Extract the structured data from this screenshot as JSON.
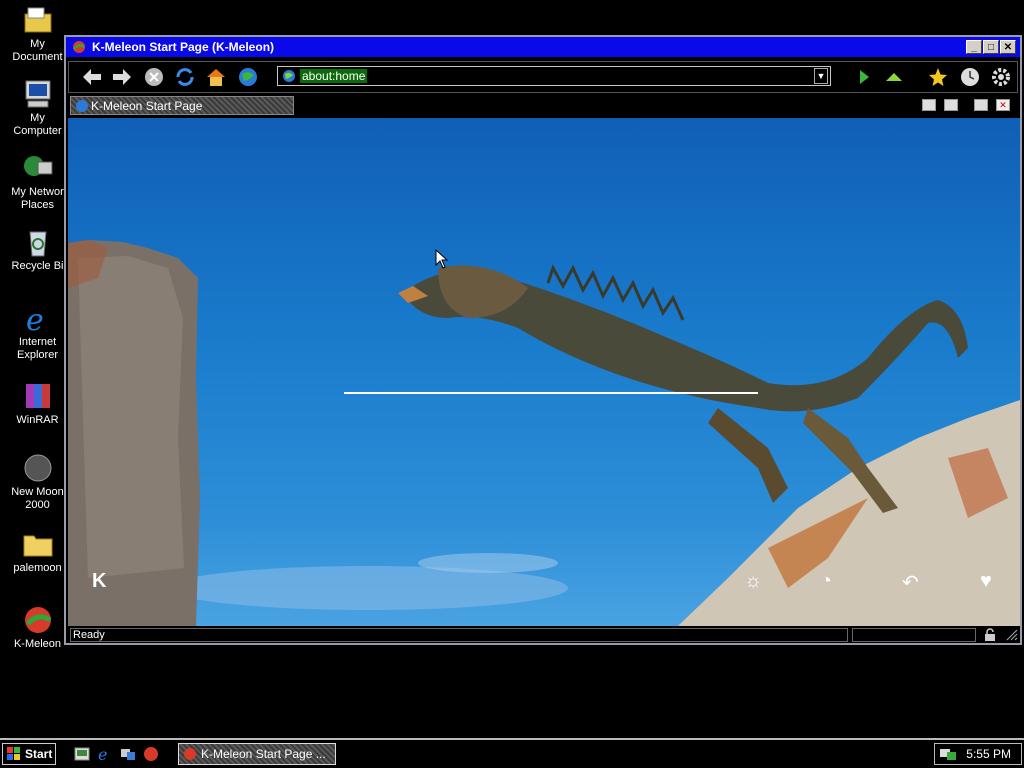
{
  "desktop": {
    "icons": [
      {
        "label": "My\nDocument"
      },
      {
        "label": "My\nComputer"
      },
      {
        "label": "My Networ\nPlaces"
      },
      {
        "label": "Recycle Bi"
      },
      {
        "label": "Internet\nExplorer"
      },
      {
        "label": "WinRAR"
      },
      {
        "label": "New Moon\n2000"
      },
      {
        "label": "palemoon"
      },
      {
        "label": "K-Meleon"
      }
    ]
  },
  "window": {
    "title": "K-Meleon Start Page (K-Meleon)",
    "title_bar_color": "#0a0ae8",
    "url": "about:home",
    "tab_label": "K-Meleon Start Page",
    "status_text": "Ready",
    "toolbar_icons": [
      "back-icon",
      "forward-icon",
      "stop-icon",
      "reload-icon",
      "home-icon",
      "globe-icon",
      "go-icon",
      "up-icon",
      "bookmarks-icon",
      "history-icon",
      "settings-icon"
    ],
    "page_glyphs": [
      "K",
      "☼",
      "◔",
      "↶",
      "♥"
    ]
  },
  "taskbar": {
    "start_label": "Start",
    "task_label": "K-Meleon Start Page ...",
    "clock": "5:55 PM"
  }
}
